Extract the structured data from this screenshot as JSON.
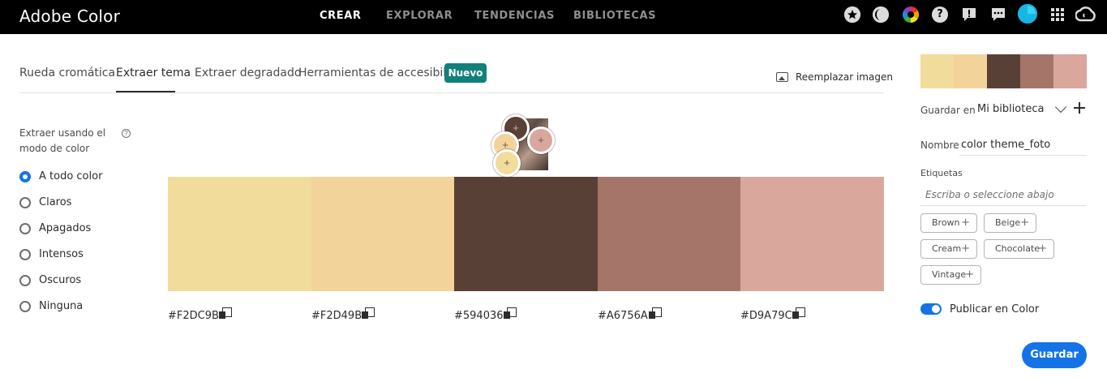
{
  "app": {
    "title": "Adobe Color"
  },
  "nav": [
    {
      "label": "CREAR",
      "active": true
    },
    {
      "label": "EXPLORAR",
      "active": false
    },
    {
      "label": "TENDENCIAS",
      "active": false
    },
    {
      "label": "BIBLIOTECAS",
      "active": false
    }
  ],
  "top_icons": [
    "star-icon",
    "moon-icon",
    "color-wheel-icon",
    "help-icon",
    "alert-icon",
    "chat-icon",
    "avatar",
    "apps-grid-icon",
    "creative-cloud-icon"
  ],
  "help_glyph": "?",
  "alert_glyph": "!",
  "tabs": [
    {
      "label": "Rueda cromática",
      "active": false
    },
    {
      "label": "Extraer tema",
      "active": true
    },
    {
      "label": "Extraer degradado",
      "active": false
    },
    {
      "label": "Herramientas de accesibilidad",
      "active": false
    }
  ],
  "new_badge": "Nuevo",
  "replace_image": "Reemplazar imagen",
  "mode": {
    "title": "Extraer usando el modo de color",
    "info_glyph": "?",
    "options": [
      {
        "label": "A todo color",
        "selected": true
      },
      {
        "label": "Claros",
        "selected": false
      },
      {
        "label": "Apagados",
        "selected": false
      },
      {
        "label": "Intensos",
        "selected": false
      },
      {
        "label": "Oscuros",
        "selected": false
      },
      {
        "label": "Ninguna",
        "selected": false
      }
    ]
  },
  "picker_glyph": "+",
  "swatches": [
    {
      "hex": "#F2DC9B",
      "color": "#f2dc9b"
    },
    {
      "hex": "#F2D49B",
      "color": "#f2d49b"
    },
    {
      "hex": "#594036",
      "color": "#594036"
    },
    {
      "hex": "#A6756A",
      "color": "#a6756a"
    },
    {
      "hex": "#D9A79C",
      "color": "#d9a79c"
    }
  ],
  "side": {
    "save_in_label": "Guardar en",
    "library": "Mi biblioteca",
    "name_label": "Nombre",
    "name_value": "color theme_foto",
    "tags_label": "Etiquetas",
    "tags_placeholder": "Escriba o seleccione abajo",
    "tags": [
      "Brown",
      "Beige",
      "Cream",
      "Chocolate",
      "Vintage"
    ],
    "tag_plus": "+",
    "publish_label": "Publicar en Color",
    "publish_on": true,
    "save_label": "Guardar"
  },
  "colors": {
    "accent": "#1473e6",
    "badge": "#12807a",
    "topbar": "#000000"
  }
}
